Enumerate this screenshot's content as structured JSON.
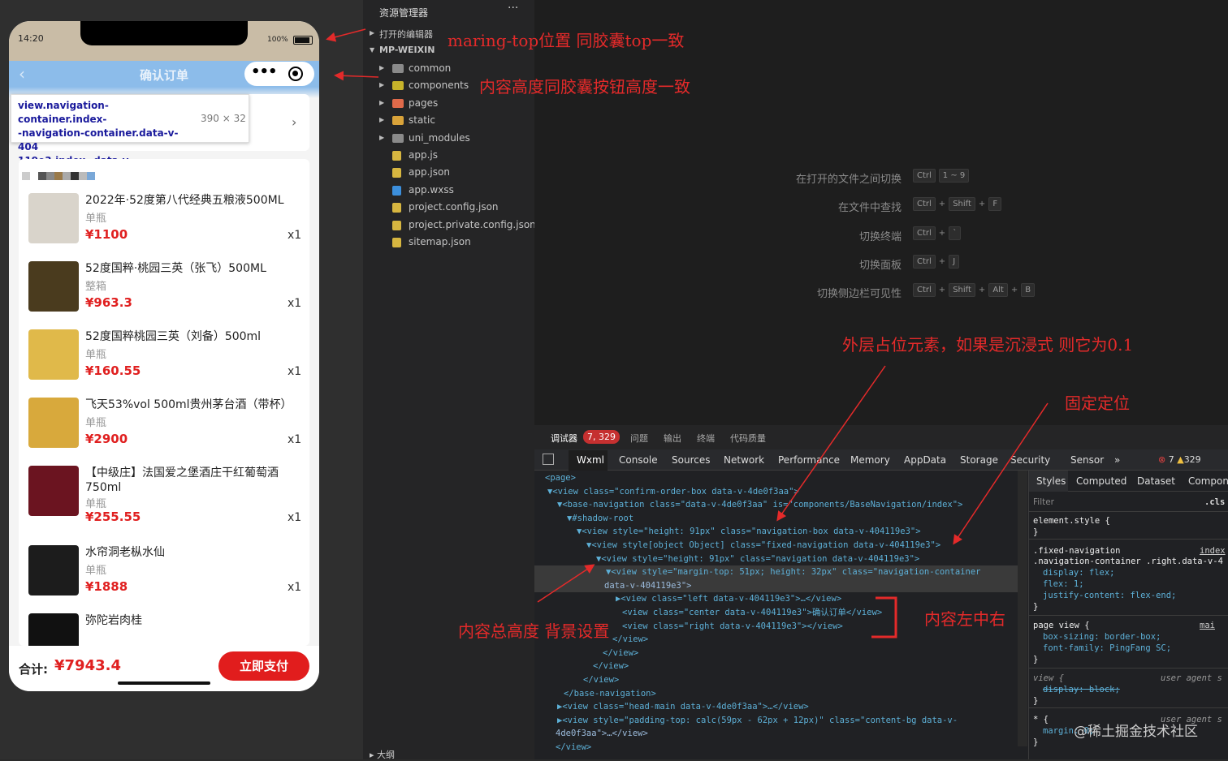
{
  "phone": {
    "time": "14:20",
    "battery": "100%",
    "nav_title": "确认订单",
    "inspect_tooltip": "view.navigation-container.index-\n-navigation-container.data-v-404\n119e3.index--data-v...",
    "inspect_size": "390 × 32",
    "items": [
      {
        "name": "2022年·52度第八代经典五粮液500ML",
        "spec": "单瓶",
        "price": "¥1100",
        "qty": "x1",
        "img": "#d9d4cb"
      },
      {
        "name": "52度国粹·桃园三英（张飞）500ML",
        "spec": "整箱",
        "price": "¥963.3",
        "qty": "x1",
        "img": "#4a3b1e"
      },
      {
        "name": "52度国粹桃园三英（刘备）500ml",
        "spec": "单瓶",
        "price": "¥160.55",
        "qty": "x1",
        "img": "#e0b94a"
      },
      {
        "name": "飞天53%vol 500ml贵州茅台酒（带杯）",
        "spec": "单瓶",
        "price": "¥2900",
        "qty": "x1",
        "img": "#d8a93c"
      },
      {
        "name": "【中级庄】法国爱之堡酒庄干红葡萄酒750ml",
        "spec": "单瓶",
        "price": "¥255.55",
        "qty": "x1",
        "img": "#6b1420"
      },
      {
        "name": "水帘洞老枞水仙",
        "spec": "单瓶",
        "price": "¥1888",
        "qty": "x1",
        "img": "#1c1c1c"
      },
      {
        "name": "弥陀岩肉桂",
        "spec": "",
        "price": "",
        "qty": "",
        "img": "#111111"
      }
    ],
    "total_label": "合计:",
    "total_value": "¥7943.4",
    "pay_button": "立即支付"
  },
  "explorer": {
    "title": "资源管理器",
    "more": "···",
    "open_editors": "打开的编辑器",
    "project": "MP-WEIXIN",
    "tree": [
      {
        "label": "common",
        "icon_color": "#8a8a8a",
        "chevron": "▶"
      },
      {
        "label": "components",
        "icon_color": "#c7b32a",
        "chevron": "▶"
      },
      {
        "label": "pages",
        "icon_color": "#e06a4a",
        "chevron": "▶"
      },
      {
        "label": "static",
        "icon_color": "#d9a33a",
        "chevron": "▶"
      },
      {
        "label": "uni_modules",
        "icon_color": "#8a8a8a",
        "chevron": "▶"
      },
      {
        "label": "app.js",
        "icon_color": "#d7b640",
        "chevron": ""
      },
      {
        "label": "app.json",
        "icon_color": "#d7b640",
        "chevron": ""
      },
      {
        "label": "app.wxss",
        "icon_color": "#3c8fdc",
        "chevron": ""
      },
      {
        "label": "project.config.json",
        "icon_color": "#d7b640",
        "chevron": ""
      },
      {
        "label": "project.private.config.json",
        "icon_color": "#d7b640",
        "chevron": ""
      },
      {
        "label": "sitemap.json",
        "icon_color": "#d7b640",
        "chevron": ""
      }
    ],
    "outline": "大纲"
  },
  "shortcuts": [
    {
      "label": "在打开的文件之间切换",
      "keys": [
        "Ctrl",
        "1 ~ 9"
      ]
    },
    {
      "label": "在文件中查找",
      "keys": [
        "Ctrl",
        "+",
        "Shift",
        "+",
        "F"
      ]
    },
    {
      "label": "切换终端",
      "keys": [
        "Ctrl",
        "+",
        "`"
      ]
    },
    {
      "label": "切换面板",
      "keys": [
        "Ctrl",
        "+",
        "J"
      ]
    },
    {
      "label": "切换侧边栏可见性",
      "keys": [
        "Ctrl",
        "+",
        "Shift",
        "+",
        "Alt",
        "+",
        "B"
      ]
    }
  ],
  "devtools": {
    "top_tabs": [
      "调试器",
      "问题",
      "输出",
      "终端",
      "代码质量"
    ],
    "badge": "7, 329",
    "panel_tabs": [
      "Wxml",
      "Console",
      "Sources",
      "Network",
      "Performance",
      "Memory",
      "AppData",
      "Storage",
      "Security",
      "Sensor",
      "»"
    ],
    "errors": "7",
    "warnings": "329",
    "styles_tabs": [
      "Styles",
      "Computed",
      "Dataset",
      "Component"
    ],
    "filter_placeholder": "Filter",
    "cls": ".cls",
    "dom": [
      "<page>",
      "▼<view class=\"confirm-order-box data-v-4de0f3aa\">",
      "▼<base-navigation class=\"data-v-4de0f3aa\" is=\"components/BaseNavigation/index\">",
      "▼#shadow-root",
      "▼<view style=\"height: 91px\" class=\"navigation-box data-v-404119e3\">",
      "▼<view style[object Object] class=\"fixed-navigation data-v-404119e3\">",
      "▼<view style=\"height: 91px\" class=\"navigation data-v-404119e3\">",
      "▼<view style=\"margin-top: 51px; height: 32px\" class=\"navigation-container",
      "data-v-404119e3\">",
      "▶<view class=\"left data-v-404119e3\">…</view>",
      "<view class=\"center data-v-404119e3\">确认订单</view>",
      "<view class=\"right data-v-404119e3\"></view>",
      "</view>",
      "</view>",
      "</view>",
      "</view>",
      "</base-navigation>",
      "▶<view class=\"head-main data-v-4de0f3aa\">…</view>",
      "▶<view style=\"padding-top: calc(59px - 62px + 12px)\" class=\"content-bg data-v-",
      "4de0f3aa\">…</view>",
      "</view>"
    ],
    "styles": [
      "element.style {",
      "}",
      ".fixed-navigation",
      ".navigation-container .right.data-v-4",
      "display: flex;",
      "flex: 1;",
      "justify-content: flex-end;",
      "}",
      "page view {",
      "box-sizing: border-box;",
      "font-family: PingFang SC;",
      "}",
      "view {",
      "display: block;",
      "}",
      "* {",
      "margin: 0;",
      "}"
    ],
    "style_sources": [
      "index",
      "mai",
      "user agent s",
      "user agent s"
    ]
  },
  "annotations": [
    "maring-top位置 同胶囊top一致",
    "内容高度同胶囊按钮高度一致",
    "外层占位元素，如果是沉浸式 则它为0.1",
    "固定定位",
    "内容总高度 背景设置",
    "内容左中右"
  ],
  "watermark": "@稀土掘金技术社区"
}
